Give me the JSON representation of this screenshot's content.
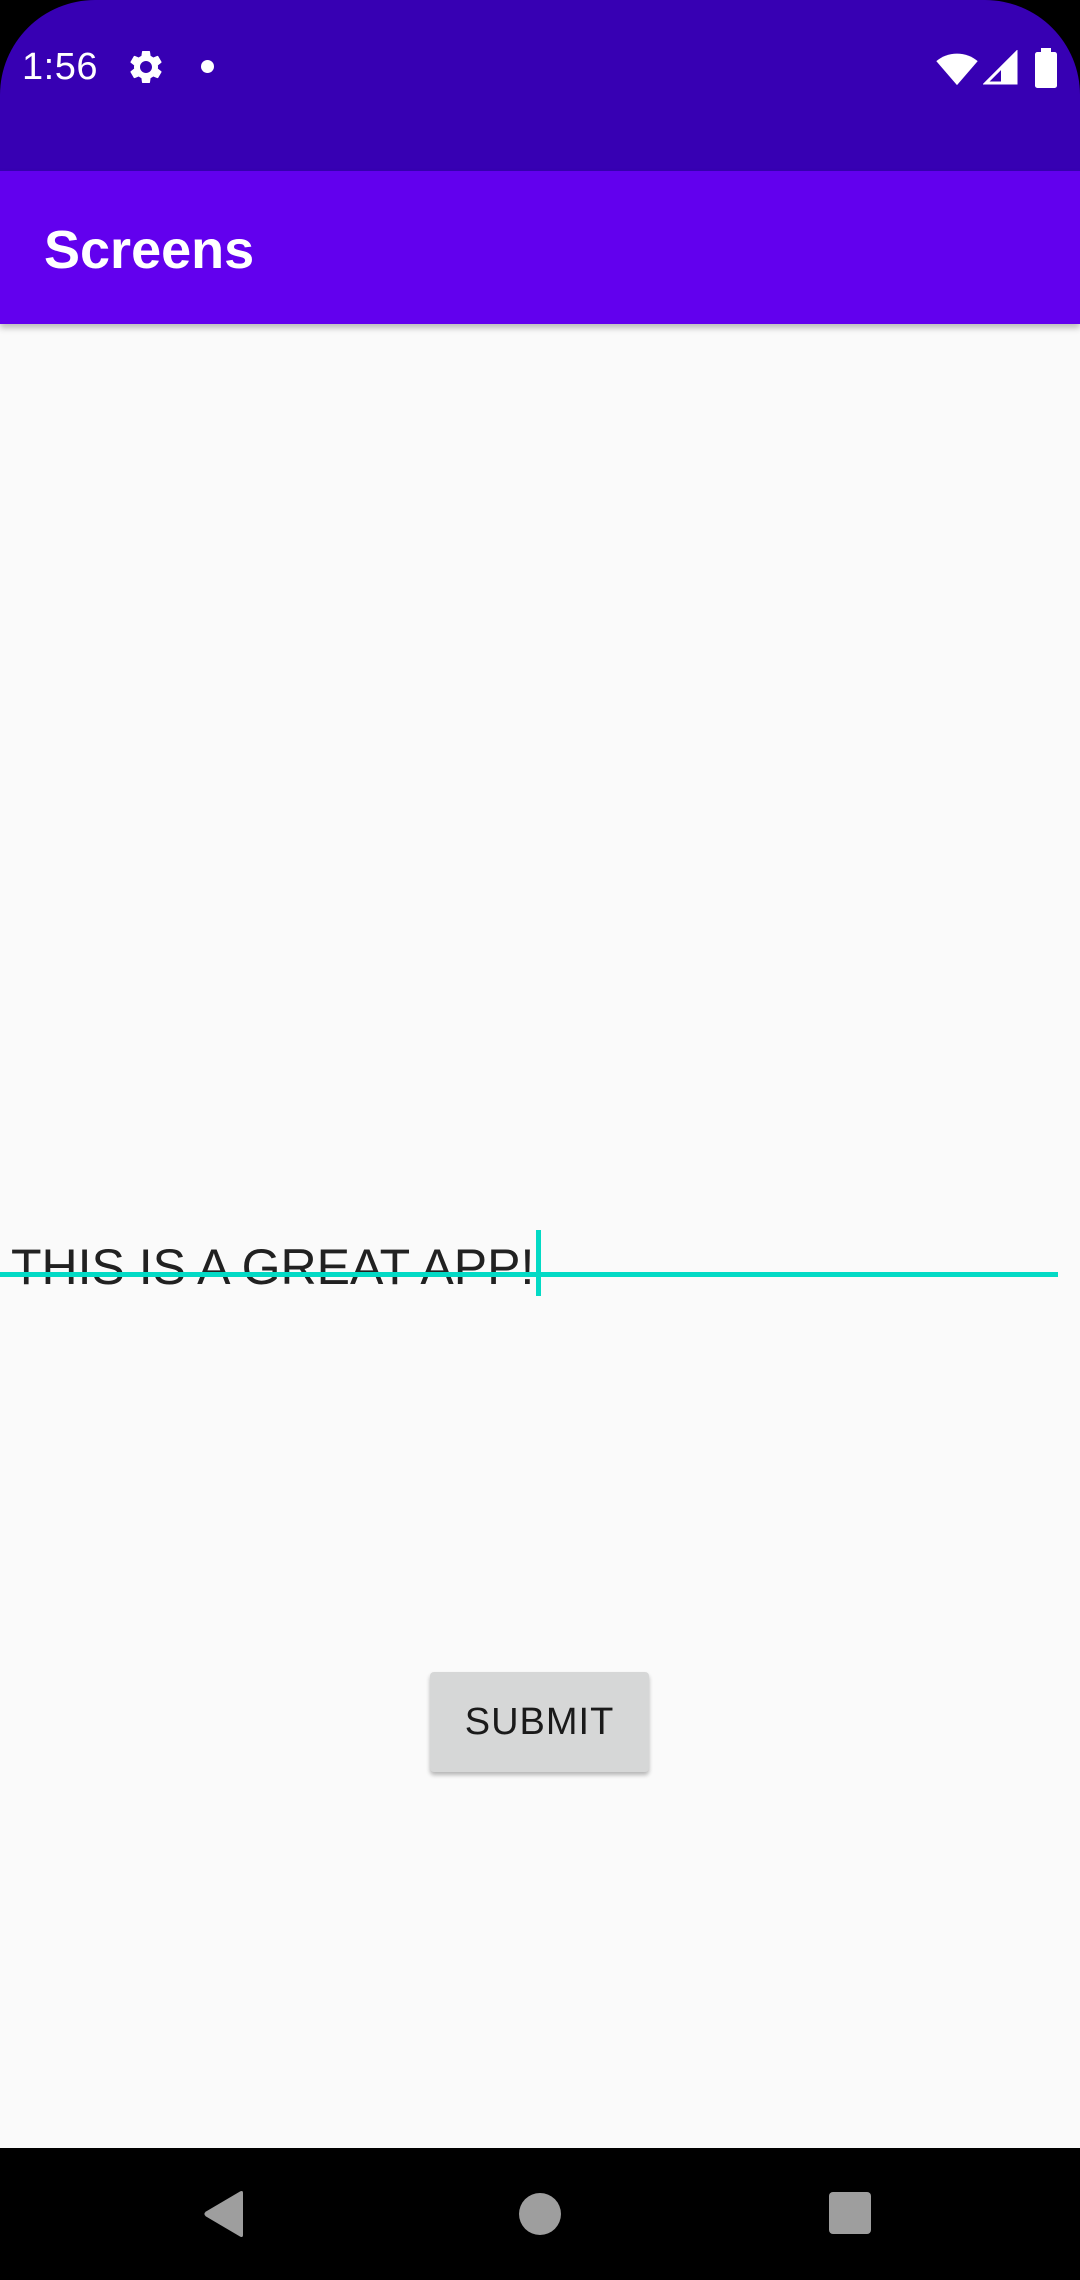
{
  "status_bar": {
    "time": "1:56",
    "icons": [
      "gear-icon",
      "notification-dot-icon",
      "wifi-icon",
      "signal-icon",
      "battery-icon"
    ],
    "background": "#3700B3"
  },
  "app_bar": {
    "title": "Screens",
    "background": "#6200EE"
  },
  "main": {
    "text_field": {
      "value": "THIS IS A GREAT APP!",
      "focused": true,
      "accent": "#03DAC5"
    },
    "submit_button": {
      "label": "SUBMIT"
    },
    "background": "#FAFAFA"
  },
  "nav_bar": {
    "icons": [
      "back-icon",
      "home-icon",
      "recents-icon"
    ]
  }
}
